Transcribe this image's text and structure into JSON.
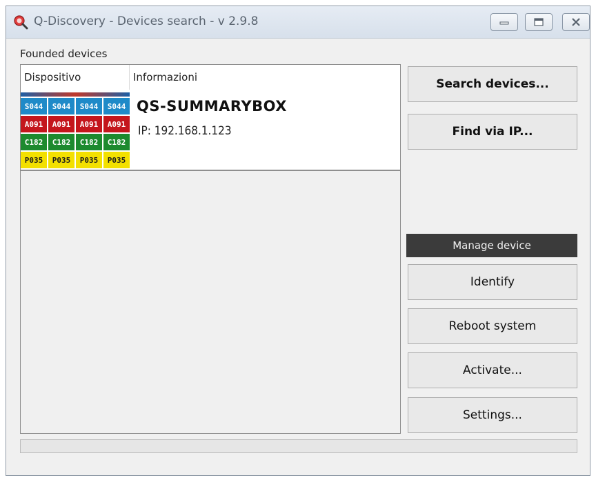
{
  "window": {
    "title": "Q-Discovery - Devices search - v 2.9.8",
    "icons": {
      "app": "q-discovery-logo-icon",
      "minimize": "minimize-icon",
      "maximize": "maximize-icon",
      "close": "close-icon"
    }
  },
  "devices": {
    "section_label": "Founded devices",
    "columns": [
      "Dispositivo",
      "Informazioni"
    ],
    "items": [
      {
        "name": "QS-SUMMARYBOX",
        "ip": "IP: 192.168.1.123",
        "thumbnail_tiles": [
          {
            "text": "S044",
            "color": "blue"
          },
          {
            "text": "S044",
            "color": "blue"
          },
          {
            "text": "S044",
            "color": "blue"
          },
          {
            "text": "S044",
            "color": "blue"
          },
          {
            "text": "A091",
            "color": "red"
          },
          {
            "text": "A091",
            "color": "red"
          },
          {
            "text": "A091",
            "color": "red"
          },
          {
            "text": "A091",
            "color": "red"
          },
          {
            "text": "C182",
            "color": "green"
          },
          {
            "text": "C182",
            "color": "green"
          },
          {
            "text": "C182",
            "color": "green"
          },
          {
            "text": "C182",
            "color": "green"
          },
          {
            "text": "P035",
            "color": "yellow"
          },
          {
            "text": "P035",
            "color": "yellow"
          },
          {
            "text": "P035",
            "color": "yellow"
          },
          {
            "text": "P035",
            "color": "yellow"
          }
        ]
      }
    ]
  },
  "actions": {
    "search_devices": "Search devices...",
    "find_via_ip": "Find via IP...",
    "manage_header": "Manage device",
    "identify": "Identify",
    "reboot_system": "Reboot system",
    "activate": "Activate...",
    "settings": "Settings..."
  },
  "progress": {
    "value": 0
  },
  "colors": {
    "manage_header_bg": "#3b3b3b",
    "button_bg": "#e9e9e9",
    "window_bg": "#f0f0f0"
  }
}
